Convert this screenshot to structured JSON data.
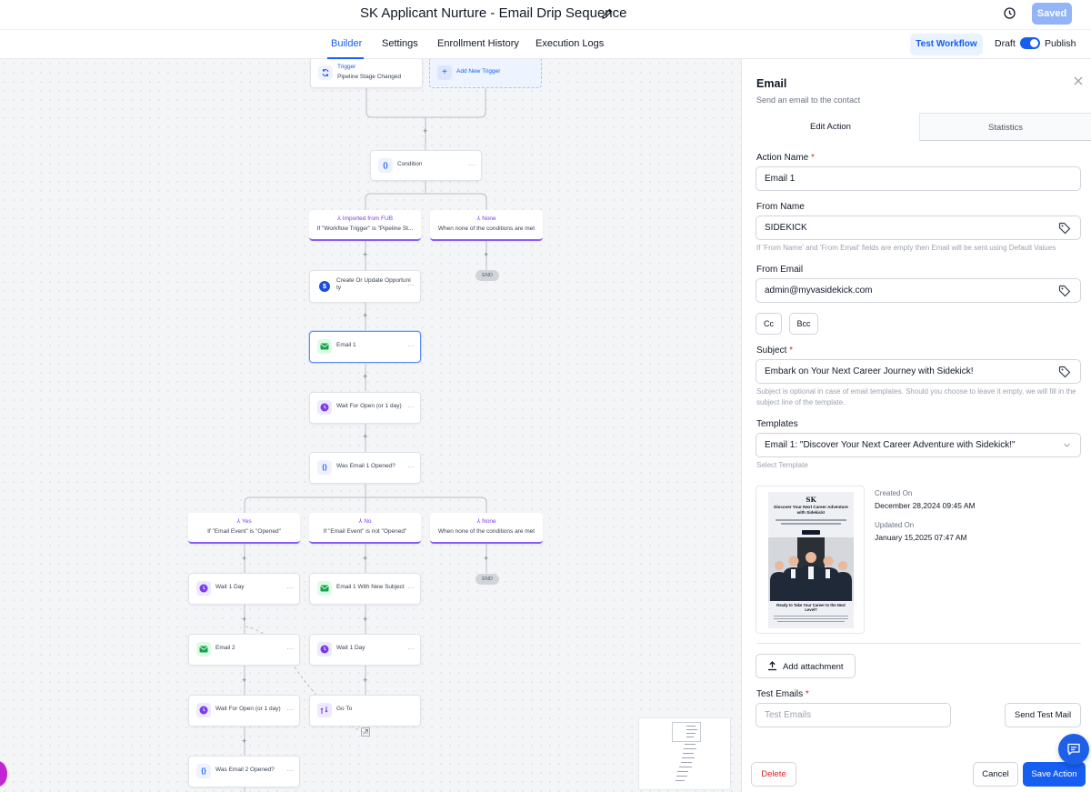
{
  "header": {
    "title": "SK Applicant Nurture - Email Drip Sequence",
    "saved_label": "Saved",
    "tabs": [
      {
        "label": "Builder",
        "active": true
      },
      {
        "label": "Settings",
        "active": false
      },
      {
        "label": "Enrollment History",
        "active": false
      },
      {
        "label": "Execution Logs",
        "active": false
      }
    ],
    "test_workflow_label": "Test Workflow",
    "draft_label": "Draft",
    "publish_label": "Publish",
    "publish_on": true
  },
  "canvas": {
    "trigger": {
      "title": "Trigger",
      "subtitle": "Pipeline Stage Changed"
    },
    "add_trigger_label": "Add New Trigger",
    "nodes": {
      "condition": "Condition",
      "create_update": "Create Or Update Opportuni ty",
      "email1": "Email 1",
      "wait_open": "Wait For Open (or 1 day)",
      "was_opened1": "Was Email 1 Opened?",
      "wait1day_a": "Wait 1 Day",
      "email1_new": "Email 1 With New Subject",
      "email2": "Email 2",
      "wait1day_b": "Wait 1 Day",
      "wait_open2": "Wait For Open (or 1 day)",
      "goto": "Go To",
      "was_opened2": "Was Email 2 Opened?"
    },
    "branches": {
      "fub": {
        "title": "Imported from FUB",
        "subtitle": "If \"Workflow Trigger\" is \"Pipeline St..."
      },
      "none1": {
        "title": "None",
        "subtitle": "When none of the conditions are met"
      },
      "yes": {
        "title": "Yes",
        "subtitle": "If \"Email Event\" is \"Opened\""
      },
      "no": {
        "title": "No",
        "subtitle": "If \"Email Event\" is not \"Opened\""
      },
      "none2": {
        "title": "None",
        "subtitle": "When none of the conditions are met"
      }
    },
    "end_label": "END",
    "dots": "···"
  },
  "panel": {
    "title": "Email",
    "subtitle": "Send an email to the contact",
    "tabs": {
      "edit": "Edit Action",
      "stats": "Statistics"
    },
    "action_name": {
      "label": "Action Name",
      "value": "Email 1"
    },
    "from_name": {
      "label": "From Name",
      "value": "SIDEKICK",
      "hint": "If 'From Name' and 'From Email' fields are empty then Email will be sent using Default Values"
    },
    "from_email": {
      "label": "From Email",
      "value": "admin@myvasidekick.com"
    },
    "cc_label": "Cc",
    "bcc_label": "Bcc",
    "subject": {
      "label": "Subject",
      "value": "Embark on Your Next Career Journey with Sidekick!",
      "hint": "Subject is optional in case of email templates. Should you choose to leave it empty, we will fill in the subject line of the template."
    },
    "templates": {
      "label": "Templates",
      "value": "Email 1: \"Discover Your Next Career Adventure with Sidekick!\"",
      "hint": "Select Template"
    },
    "template_preview": {
      "logo": "SK",
      "headline": "Discover Your Next Career Adventure with Sidekick!",
      "footer": "Ready to Take Your Career to the Next Level?"
    },
    "created_on": {
      "label": "Created On",
      "value": "December 28,2024 09:45 AM"
    },
    "updated_on": {
      "label": "Updated On",
      "value": "January 15,2025 07:47 AM"
    },
    "add_attachment_label": "Add attachment",
    "test_emails": {
      "label": "Test Emails",
      "placeholder": "Test Emails"
    },
    "send_test_label": "Send Test Mail",
    "delete_label": "Delete",
    "cancel_label": "Cancel",
    "save_label": "Save Action",
    "required_mark": "*"
  },
  "colors": {
    "accent": "#155eef",
    "branch": "#8b5cf6",
    "email_icon": "#16a34a",
    "wait_icon": "#7c3aed",
    "danger": "#dc2626"
  }
}
